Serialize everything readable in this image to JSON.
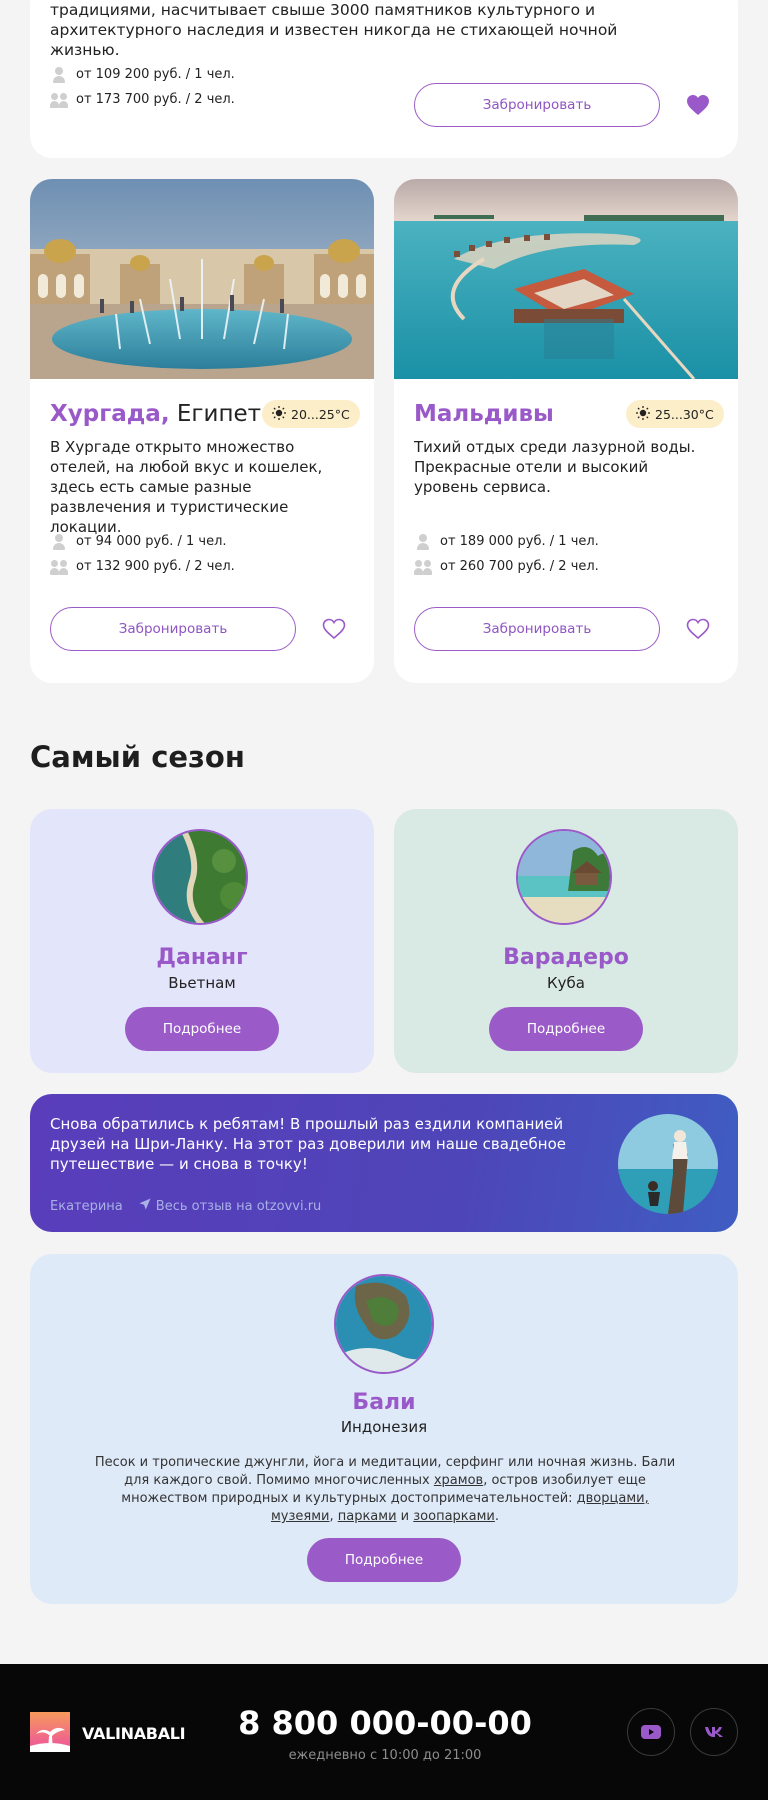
{
  "top_card": {
    "description": "традициями, насчитывает свыше 3000 памятников культурного и архитектурного наследия и известен никогда не стихающей ночной жизнью.",
    "price_one": "от 109 200 руб. / 1 чел.",
    "price_two": "от 173 700 руб. / 2 чел.",
    "book_label": "Забронировать",
    "favorited": true
  },
  "destinations": [
    {
      "city": "Хургада,",
      "country": " Египет",
      "weather": "20...25°C",
      "text": "В Хургаде открыто множество отелей, на любой вкус и кошелек, здесь есть самые разные развлечения и туристические локации.",
      "price_one": "от 94 000 руб. / 1 чел.",
      "price_two": "от 132 900 руб. / 2 чел.",
      "book_label": "Забронировать",
      "favorited": false
    },
    {
      "city": "Мальдивы",
      "country": "",
      "weather": "25...30°C",
      "text": "Тихий отдых среди лазурной воды. Прекрасные отели и высокий уровень сервиса.",
      "price_one": "от 189 000 руб. / 1 чел.",
      "price_two": "от 260 700 руб. / 2 чел.",
      "book_label": "Забронировать",
      "favorited": false
    }
  ],
  "season": {
    "title": "Самый сезон",
    "cards": [
      {
        "city": "Дананг",
        "country": "Вьетнам",
        "button": "Подробнее",
        "bg": "#e3e5fa"
      },
      {
        "city": "Варадеро",
        "country": "Куба",
        "button": "Подробнее",
        "bg": "#d9e9e4"
      }
    ]
  },
  "review": {
    "quote": "Снова обратились к ребятам! В прошлый раз ездили компанией друзей на Шри-Ланку. На этот раз доверили им наше свадебное путешествие — и снова в точку!",
    "author": "Екатерина",
    "link": "Весь отзыв на otzovvi.ru"
  },
  "bali": {
    "city": "Бали",
    "country": "Индонезия",
    "para_1": "Песок и тропические джунгли, йога и медитации, серфинг или ночная жизнь. Бали для каждого свой. Помимо многочисленных ",
    "link_temples": "храмов",
    "para_2": ", остров изобилует еще множеством природных и культурных достопримечательностей: ",
    "link_palaces": "дворцами, музеями",
    "sep_1": ", ",
    "link_parks": "парками",
    "sep_2": " и ",
    "link_zoo": "зоопарками",
    "end": ".",
    "button": "Подробнее"
  },
  "footer": {
    "brand": "VALINABALI",
    "phone": "8 800 000-00-00",
    "hours": "ежедневно с 10:00 до 21:00",
    "social": [
      "youtube-icon",
      "vk-icon"
    ]
  },
  "colors": {
    "accent": "#9a5ac8",
    "footer_bg": "#070707",
    "weather_bg": "#fbeec8"
  }
}
